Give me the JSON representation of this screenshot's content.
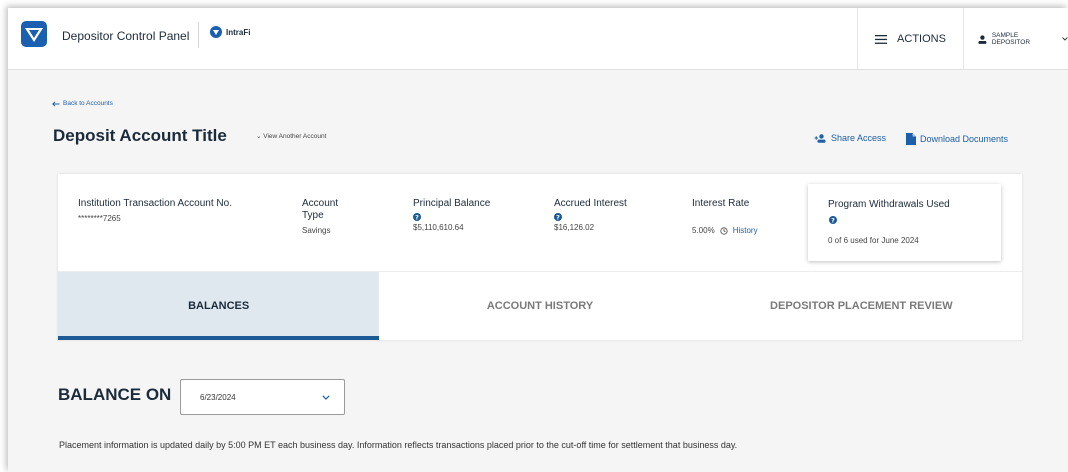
{
  "header": {
    "app_title": "Depositor Control Panel",
    "brand": "IntraFi",
    "actions_label": "ACTIONS",
    "user_label": "SAMPLE DEPOSITOR"
  },
  "page": {
    "back_link": "Back to Accounts",
    "title": "Deposit Account Title",
    "view_another": "View Another Account",
    "share_access": "Share Access",
    "download_documents": "Download Documents"
  },
  "account": {
    "number_label": "Institution Transaction Account No.",
    "number_value": "********7265",
    "type_label": "Account Type",
    "type_value": "Savings",
    "principal_label": "Principal Balance",
    "principal_value": "$5,110,610.64",
    "interest_label": "Accrued Interest",
    "interest_value": "$16,126.02",
    "rate_label": "Interest Rate",
    "rate_value": "5.00%",
    "rate_history": "History",
    "withdrawals_label": "Program Withdrawals Used",
    "withdrawals_value": "0 of 6 used for June 2024"
  },
  "tabs": [
    {
      "label": "BALANCES",
      "active": true
    },
    {
      "label": "ACCOUNT HISTORY",
      "active": false
    },
    {
      "label": "DEPOSITOR PLACEMENT REVIEW",
      "active": false
    }
  ],
  "balance": {
    "label": "BALANCE ON",
    "date": "6/23/2024",
    "notice": "Placement information is updated daily by 5:00 PM ET each business day. Information reflects transactions placed prior to the cut-off time for settlement that business day."
  },
  "colors": {
    "accent": "#1d5fa8",
    "active_tab_bg": "#dfe8ef",
    "active_tab_bar": "#1b5a94",
    "text_dark": "#1c2b3a"
  },
  "icons": [
    "intrafi-logo-icon",
    "hamburger-menu-icon",
    "user-icon",
    "chevron-down-icon",
    "arrow-left-icon",
    "add-user-icon",
    "document-icon",
    "help-icon",
    "history-icon"
  ]
}
